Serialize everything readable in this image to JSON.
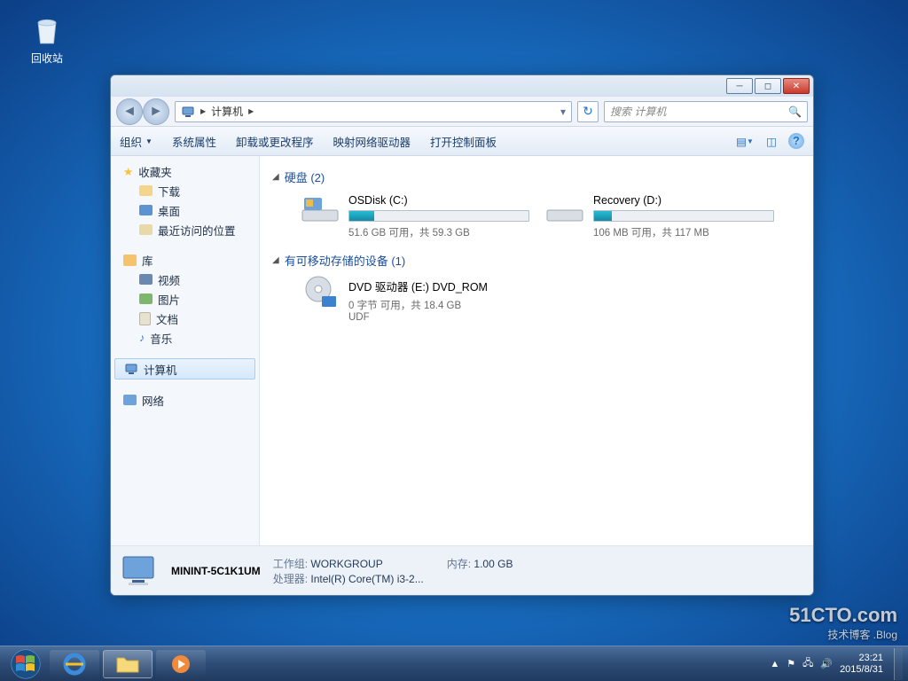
{
  "desktop": {
    "recycle_bin": "回收站"
  },
  "window": {
    "breadcrumb_icon": "computer-icon",
    "breadcrumb": "计算机",
    "breadcrumb_sep": "▶",
    "search_placeholder": "搜索 计算机",
    "toolbar": {
      "organize": "组织",
      "properties": "系统属性",
      "uninstall": "卸载或更改程序",
      "mapdrive": "映射网络驱动器",
      "controlpanel": "打开控制面板"
    }
  },
  "sidebar": {
    "favorites": "收藏夹",
    "downloads": "下载",
    "desktop": "桌面",
    "recent": "最近访问的位置",
    "libraries": "库",
    "videos": "视频",
    "pictures": "图片",
    "documents": "文档",
    "music": "音乐",
    "computer": "计算机",
    "network": "网络"
  },
  "content": {
    "hdd_header": "硬盘 (2)",
    "removable_header": "有可移动存储的设备 (1)",
    "drives": [
      {
        "name": "OSDisk (C:)",
        "status": "51.6 GB 可用，共 59.3 GB",
        "fill_pct": 14
      },
      {
        "name": "Recovery (D:)",
        "status": "106 MB 可用，共 117 MB",
        "fill_pct": 10
      }
    ],
    "dvd": {
      "name": "DVD 驱动器 (E:) DVD_ROM",
      "status": "0 字节 可用，共 18.4 GB",
      "fs": "UDF"
    }
  },
  "details": {
    "computer_name": "MININT-5C1K1UM",
    "workgroup_k": "工作组:",
    "workgroup_v": "WORKGROUP",
    "cpu_k": "处理器:",
    "cpu_v": "Intel(R) Core(TM) i3-2...",
    "mem_k": "内存:",
    "mem_v": "1.00 GB"
  },
  "taskbar": {
    "time": "23:21",
    "date": "2015/8/31"
  },
  "watermark": {
    "main": "51CTO.com",
    "sub": "技术博客 .Blog"
  }
}
